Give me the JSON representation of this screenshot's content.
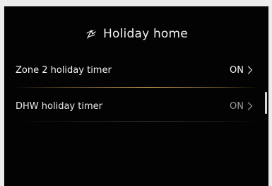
{
  "header": {
    "title": "Holiday home",
    "icon": "holiday-icon"
  },
  "settings": [
    {
      "label": "Zone 2 holiday timer",
      "value": "ON",
      "icon": "chevron-right-icon"
    },
    {
      "label": "DHW holiday timer",
      "value": "ON",
      "icon": "chevron-right-icon"
    }
  ],
  "colors": {
    "screen_background": "#030303",
    "frame_background": "#ececec",
    "accent_divider": "#d7aa5a",
    "text_primary": "#f4f4f4",
    "text_dim": "#9a9a9a"
  }
}
